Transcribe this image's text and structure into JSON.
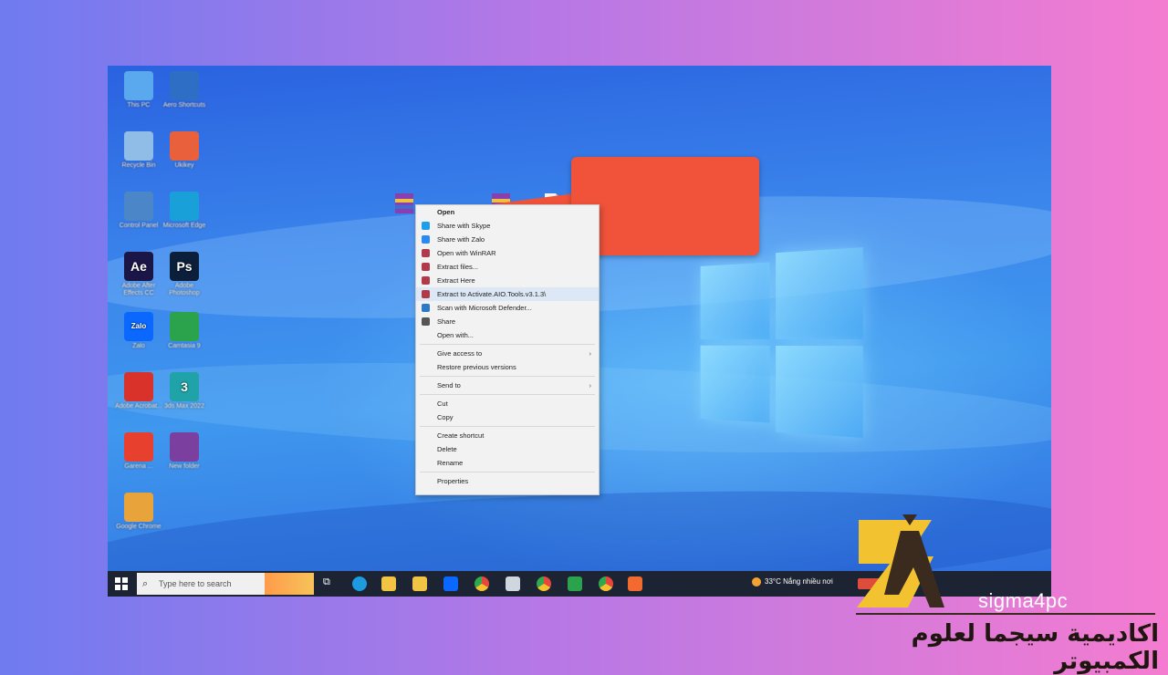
{
  "desktop_icons": [
    {
      "label": "This PC",
      "icon": "this-pc-icon",
      "color": "#5aa9ef"
    },
    {
      "label": "Aero Shortcuts",
      "icon": "shortcut-icon",
      "color": "#2e6fc5"
    },
    {
      "label": "Recycle Bin",
      "icon": "recycle-bin-icon",
      "color": "#8fbde8"
    },
    {
      "label": "Ukikey",
      "icon": "ukikey-icon",
      "color": "#e8603c"
    },
    {
      "label": "Control Panel",
      "icon": "control-panel-icon",
      "color": "#4a86c8"
    },
    {
      "label": "Microsoft Edge",
      "icon": "edge-icon",
      "color": "#1aa0d8"
    },
    {
      "label": "Adobe After Effects CC",
      "icon": "after-effects-icon",
      "color": "#1b1648",
      "glyph": "Ae"
    },
    {
      "label": "Adobe Photoshop",
      "icon": "photoshop-icon",
      "color": "#0b1f3a",
      "glyph": "Ps"
    },
    {
      "label": "Zalo",
      "icon": "zalo-icon",
      "color": "#0a68ff",
      "glyph": "Zalo"
    },
    {
      "label": "Camtasia 9",
      "icon": "camtasia-icon",
      "color": "#2ba24c"
    },
    {
      "label": "Adobe Acrobat...",
      "icon": "acrobat-icon",
      "color": "#d8322a"
    },
    {
      "label": "3ds Max 2022",
      "icon": "3dsmax-icon",
      "color": "#1fa3a8",
      "glyph": "3"
    },
    {
      "label": "Garena ...",
      "icon": "garena-icon",
      "color": "#e8402e"
    },
    {
      "label": "New folder",
      "icon": "winrar-icon",
      "color": "#7b3fa0"
    },
    {
      "label": "Google Chrome",
      "icon": "chrome-icon",
      "color": "#e8a33a"
    }
  ],
  "context_menu": {
    "items": [
      {
        "label": "Open",
        "bold": true,
        "icon": ""
      },
      {
        "label": "Share with Skype",
        "icon": "skype-icon",
        "color": "#1d9ee8"
      },
      {
        "label": "Share with Zalo",
        "icon": "zalo-small-icon",
        "color": "#2a8af0"
      },
      {
        "label": "Open with WinRAR",
        "icon": "winrar-icon",
        "color": "#b03a4a"
      },
      {
        "label": "Extract files...",
        "icon": "winrar-icon",
        "color": "#b03a4a"
      },
      {
        "label": "Extract Here",
        "icon": "winrar-icon",
        "color": "#b03a4a"
      },
      {
        "label": "Extract to Activate.AIO.Tools.v3.1.3\\",
        "icon": "winrar-icon",
        "color": "#b03a4a"
      },
      {
        "label": "Scan with Microsoft Defender...",
        "icon": "defender-icon",
        "color": "#2e78c8"
      },
      {
        "label": "Share",
        "icon": "share-icon",
        "color": "#555555"
      },
      {
        "label": "Open with...",
        "icon": ""
      },
      {
        "sep": true
      },
      {
        "label": "Give access to",
        "icon": "",
        "submenu": true
      },
      {
        "label": "Restore previous versions",
        "icon": ""
      },
      {
        "sep": true
      },
      {
        "label": "Send to",
        "icon": "",
        "submenu": true
      },
      {
        "sep": true
      },
      {
        "label": "Cut",
        "icon": ""
      },
      {
        "label": "Copy",
        "icon": ""
      },
      {
        "sep": true
      },
      {
        "label": "Create shortcut",
        "icon": ""
      },
      {
        "label": "Delete",
        "icon": ""
      },
      {
        "label": "Rename",
        "icon": ""
      },
      {
        "sep": true
      },
      {
        "label": "Properties",
        "icon": ""
      }
    ]
  },
  "taskbar": {
    "search_placeholder": "Type here to search",
    "weather": "33°C  Nắng nhiều nơi"
  },
  "brand": {
    "name": "sigma4pc",
    "tagline_ar": "اكاديمية سيجما لعلوم الكمبيوتر",
    "logo_color": "#f2c230",
    "logo_dark": "#3b2b1e"
  },
  "colors": {
    "callout": "#f0523a",
    "taskbar": "#1c2433"
  }
}
